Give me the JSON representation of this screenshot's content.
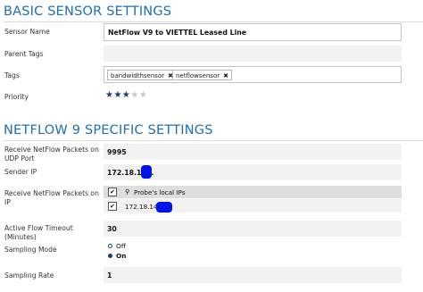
{
  "basic": {
    "title": "BASIC SENSOR SETTINGS",
    "sensor_name_label": "Sensor Name",
    "sensor_name_value": "NetFlow V9 to VIETTEL Leased Line",
    "parent_tags_label": "Parent Tags",
    "parent_tags_value": "",
    "tags_label": "Tags",
    "tags": [
      {
        "label": "bandwidthsensor",
        "remove": "✖"
      },
      {
        "label": "netflowsensor",
        "remove": "✖"
      }
    ],
    "priority_label": "Priority",
    "priority": {
      "value": 3,
      "max": 5,
      "on_glyph": "★★★",
      "off_glyph": "★★"
    }
  },
  "netflow": {
    "title": "NETFLOW 9 SPECIFIC SETTINGS",
    "udp_port_label_1": "Receive NetFlow Packets on",
    "udp_port_label_2": "UDP Port",
    "udp_port_value": "9995",
    "sender_ip_label": "Sender IP",
    "sender_ip_value": "172.18.148.",
    "receive_ip_label_1": "Receive NetFlow Packets on",
    "receive_ip_label_2": "IP",
    "ip_options": [
      {
        "label": "Probe's local IPs",
        "checked": true,
        "check_glyph": "✔",
        "icon": "pin-icon",
        "icon_glyph": "⚲"
      },
      {
        "label": "172.18.145.",
        "checked": true,
        "check_glyph": "✔"
      }
    ],
    "timeout_label_1": "Active Flow Timeout",
    "timeout_label_2": "(Minutes)",
    "timeout_value": "30",
    "sampling_mode_label": "Sampling Mode",
    "sampling_modes": [
      {
        "label": "Off",
        "selected": false
      },
      {
        "label": "On",
        "selected": true
      }
    ],
    "sampling_rate_label": "Sampling Rate",
    "sampling_rate_value": "1"
  },
  "colors": {
    "section_title": "#1f6fb0",
    "field_bg": "#f2f2f2",
    "redaction": "#0014e6",
    "star_on": "#1f3d6e",
    "star_off": "#c8c8c8"
  }
}
